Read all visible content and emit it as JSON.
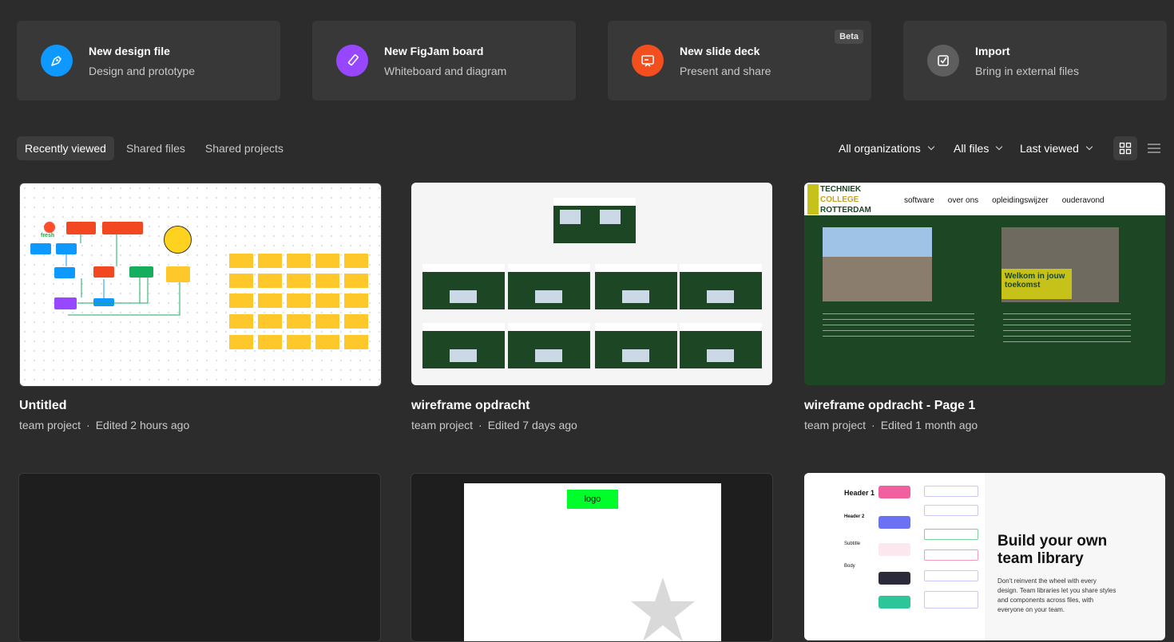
{
  "create_cards": [
    {
      "title": "New design file",
      "subtitle": "Design and prototype",
      "icon": "pen-icon",
      "color": "#0d99ff"
    },
    {
      "title": "New FigJam board",
      "subtitle": "Whiteboard and diagram",
      "icon": "marker-icon",
      "color": "#9747ff"
    },
    {
      "title": "New slide deck",
      "subtitle": "Present and share",
      "icon": "presentation-icon",
      "color": "#f24e1e",
      "badge": "Beta"
    },
    {
      "title": "Import",
      "subtitle": "Bring in external files",
      "icon": "import-icon",
      "color": "#5e5e5e"
    }
  ],
  "tabs": [
    {
      "label": "Recently viewed",
      "active": true
    },
    {
      "label": "Shared files",
      "active": false
    },
    {
      "label": "Shared projects",
      "active": false
    }
  ],
  "filters": {
    "organizations": "All organizations",
    "files": "All files",
    "sort": "Last viewed"
  },
  "view_modes": [
    "grid-view-icon",
    "list-view-icon"
  ],
  "files": [
    {
      "name": "Untitled",
      "project": "team project",
      "edited": "Edited 2 hours ago"
    },
    {
      "name": "wireframe opdracht",
      "project": "team project",
      "edited": "Edited 7 days ago"
    },
    {
      "name": "wireframe opdracht - Page 1",
      "project": "team project",
      "edited": "Edited 1 month ago"
    }
  ],
  "thumb_content": {
    "figjam_sticker": "fresh",
    "college_nav": [
      "software",
      "over ons",
      "opleidingswijzer",
      "ouderavond"
    ],
    "college_logo": [
      "TECHNIEK",
      "COLLEGE",
      "ROTTERDAM"
    ],
    "welcome_banner": "Welkom in jouw toekomst",
    "wireframe_logo": "logo",
    "library_heading": "Build your own team library",
    "library_body": "Don't reinvent the wheel with every design. Team libraries let you share styles and components across files, with everyone on your team.",
    "library_headers": [
      "Header 1",
      "Header 2",
      "Subtitle",
      "Body"
    ]
  }
}
